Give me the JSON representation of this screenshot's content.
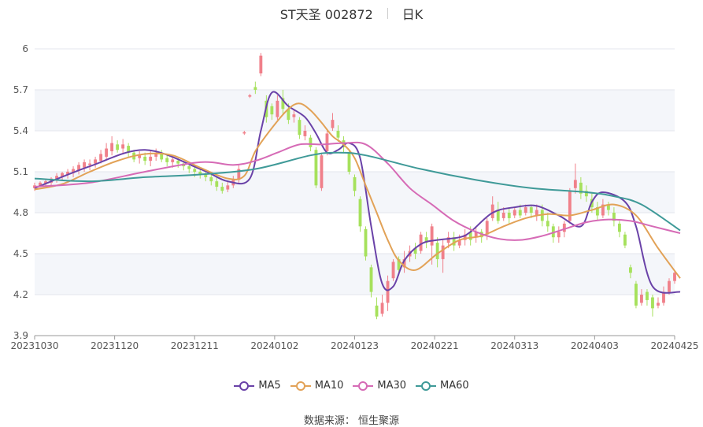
{
  "header": {
    "title": "ST天圣 002872",
    "period": "日K"
  },
  "source": "数据来源： 恒生聚源",
  "colors": {
    "up": "#f0808a",
    "down": "#a6e15c",
    "MA5": "#6a42a8",
    "MA10": "#e2a257",
    "MA30": "#d66bb6",
    "MA60": "#3f9a98"
  },
  "chart_data": {
    "type": "candlestick",
    "y_ticks": [
      "6",
      "5.7",
      "5.4",
      "5.1",
      "4.8",
      "4.5",
      "4.2",
      "3.9"
    ],
    "ylim": [
      3.9,
      6.0
    ],
    "x_tick_labels": [
      "20231030",
      "20231120",
      "20231211",
      "20240102",
      "20240123",
      "20240221",
      "20240313",
      "20240403",
      "20240425"
    ],
    "grid": true,
    "legend_position": "bottom",
    "legend": [
      "MA5",
      "MA10",
      "MA30",
      "MA60"
    ],
    "candles": [
      [
        4.98,
        5.0,
        4.96,
        5.02
      ],
      [
        5.0,
        5.02,
        4.99,
        5.03
      ],
      [
        5.01,
        5.03,
        4.99,
        5.05
      ],
      [
        5.02,
        5.05,
        5.0,
        5.06
      ],
      [
        5.04,
        5.07,
        5.02,
        5.09
      ],
      [
        5.06,
        5.09,
        5.04,
        5.1
      ],
      [
        5.08,
        5.1,
        5.05,
        5.12
      ],
      [
        5.09,
        5.12,
        5.06,
        5.14
      ],
      [
        5.11,
        5.15,
        5.08,
        5.17
      ],
      [
        5.13,
        5.17,
        5.1,
        5.19
      ],
      [
        5.15,
        5.16,
        5.11,
        5.19
      ],
      [
        5.16,
        5.19,
        5.13,
        5.21
      ],
      [
        5.18,
        5.23,
        5.16,
        5.26
      ],
      [
        5.21,
        5.27,
        5.19,
        5.31
      ],
      [
        5.25,
        5.31,
        5.22,
        5.36
      ],
      [
        5.3,
        5.26,
        5.24,
        5.33
      ],
      [
        5.27,
        5.3,
        5.23,
        5.34
      ],
      [
        5.29,
        5.24,
        5.21,
        5.31
      ],
      [
        5.24,
        5.19,
        5.17,
        5.26
      ],
      [
        5.2,
        5.22,
        5.16,
        5.25
      ],
      [
        5.21,
        5.18,
        5.15,
        5.24
      ],
      [
        5.18,
        5.21,
        5.14,
        5.25
      ],
      [
        5.21,
        5.24,
        5.18,
        5.27
      ],
      [
        5.24,
        5.19,
        5.17,
        5.26
      ],
      [
        5.2,
        5.17,
        5.14,
        5.22
      ],
      [
        5.17,
        5.19,
        5.13,
        5.21
      ],
      [
        5.18,
        5.16,
        5.13,
        5.2
      ],
      [
        5.16,
        5.14,
        5.11,
        5.18
      ],
      [
        5.14,
        5.12,
        5.09,
        5.16
      ],
      [
        5.12,
        5.1,
        5.06,
        5.14
      ],
      [
        5.1,
        5.08,
        5.05,
        5.13
      ],
      [
        5.08,
        5.06,
        5.03,
        5.11
      ],
      [
        5.06,
        5.03,
        5.0,
        5.09
      ],
      [
        5.03,
        4.99,
        4.96,
        5.06
      ],
      [
        4.99,
        4.96,
        4.94,
        5.02
      ],
      [
        4.97,
        5.0,
        4.95,
        5.03
      ],
      [
        5.0,
        5.04,
        4.98,
        5.07
      ],
      [
        5.04,
        5.12,
        5.02,
        5.15
      ],
      [
        5.38,
        5.39,
        5.37,
        5.4
      ],
      [
        5.65,
        5.66,
        5.64,
        5.67
      ],
      [
        5.72,
        5.7,
        5.67,
        5.76
      ],
      [
        5.82,
        5.95,
        5.8,
        5.97
      ],
      [
        5.62,
        5.5,
        5.46,
        5.66
      ],
      [
        5.58,
        5.52,
        5.48,
        5.6
      ],
      [
        5.5,
        5.62,
        5.48,
        5.66
      ],
      [
        5.64,
        5.56,
        5.52,
        5.7
      ],
      [
        5.56,
        5.48,
        5.45,
        5.6
      ],
      [
        5.5,
        5.52,
        5.46,
        5.56
      ],
      [
        5.48,
        5.37,
        5.34,
        5.5
      ],
      [
        5.36,
        5.4,
        5.33,
        5.44
      ],
      [
        5.35,
        5.28,
        5.25,
        5.37
      ],
      [
        5.26,
        5.0,
        4.98,
        5.28
      ],
      [
        4.98,
        5.22,
        4.96,
        5.24
      ],
      [
        5.25,
        5.38,
        5.22,
        5.4
      ],
      [
        5.42,
        5.48,
        5.4,
        5.53
      ],
      [
        5.4,
        5.35,
        5.32,
        5.44
      ],
      [
        5.33,
        5.28,
        5.24,
        5.36
      ],
      [
        5.24,
        5.1,
        5.08,
        5.26
      ],
      [
        5.06,
        4.96,
        4.92,
        5.08
      ],
      [
        4.9,
        4.7,
        4.66,
        4.92
      ],
      [
        4.68,
        4.48,
        4.45,
        4.7
      ],
      [
        4.4,
        4.22,
        4.18,
        4.42
      ],
      [
        4.12,
        4.04,
        4.02,
        4.18
      ],
      [
        4.06,
        4.14,
        4.04,
        4.2
      ],
      [
        4.14,
        4.3,
        4.08,
        4.34
      ],
      [
        4.32,
        4.44,
        4.3,
        4.46
      ],
      [
        4.46,
        4.38,
        4.34,
        4.48
      ],
      [
        4.4,
        4.46,
        4.36,
        4.52
      ],
      [
        4.48,
        4.52,
        4.44,
        4.56
      ],
      [
        4.54,
        4.5,
        4.46,
        4.58
      ],
      [
        4.52,
        4.64,
        4.5,
        4.66
      ],
      [
        4.62,
        4.58,
        4.54,
        4.66
      ],
      [
        4.56,
        4.7,
        4.42,
        4.72
      ],
      [
        4.58,
        4.46,
        4.4,
        4.62
      ],
      [
        4.46,
        4.56,
        4.36,
        4.6
      ],
      [
        4.58,
        4.62,
        4.54,
        4.66
      ],
      [
        4.62,
        4.56,
        4.52,
        4.66
      ],
      [
        4.56,
        4.6,
        4.54,
        4.64
      ],
      [
        4.6,
        4.64,
        4.56,
        4.68
      ],
      [
        4.66,
        4.6,
        4.56,
        4.7
      ],
      [
        4.62,
        4.66,
        4.58,
        4.7
      ],
      [
        4.66,
        4.62,
        4.58,
        4.68
      ],
      [
        4.64,
        4.74,
        4.6,
        4.76
      ],
      [
        4.76,
        4.86,
        4.74,
        4.92
      ],
      [
        4.82,
        4.74,
        4.72,
        4.88
      ],
      [
        4.76,
        4.8,
        4.74,
        4.84
      ],
      [
        4.8,
        4.76,
        4.72,
        4.84
      ],
      [
        4.78,
        4.82,
        4.76,
        4.84
      ],
      [
        4.82,
        4.78,
        4.76,
        4.86
      ],
      [
        4.8,
        4.84,
        4.78,
        4.86
      ],
      [
        4.84,
        4.8,
        4.76,
        4.86
      ],
      [
        4.78,
        4.82,
        4.74,
        4.86
      ],
      [
        4.82,
        4.74,
        4.7,
        4.86
      ],
      [
        4.74,
        4.7,
        4.66,
        4.8
      ],
      [
        4.7,
        4.62,
        4.58,
        4.72
      ],
      [
        4.62,
        4.66,
        4.58,
        4.7
      ],
      [
        4.66,
        4.72,
        4.62,
        4.74
      ],
      [
        4.74,
        4.96,
        4.72,
        4.98
      ],
      [
        4.98,
        5.04,
        4.94,
        5.16
      ],
      [
        5.02,
        4.94,
        4.9,
        5.06
      ],
      [
        4.96,
        4.92,
        4.88,
        5.0
      ],
      [
        4.9,
        4.84,
        4.8,
        4.94
      ],
      [
        4.84,
        4.78,
        4.74,
        4.88
      ],
      [
        4.78,
        4.86,
        4.76,
        4.9
      ],
      [
        4.86,
        4.82,
        4.78,
        4.88
      ],
      [
        4.8,
        4.74,
        4.7,
        4.84
      ],
      [
        4.72,
        4.66,
        4.62,
        4.74
      ],
      [
        4.64,
        4.56,
        4.54,
        4.66
      ],
      [
        4.4,
        4.36,
        4.32,
        4.42
      ],
      [
        4.28,
        4.12,
        4.1,
        4.3
      ],
      [
        4.14,
        4.2,
        4.12,
        4.24
      ],
      [
        4.22,
        4.16,
        4.12,
        4.24
      ],
      [
        4.18,
        4.1,
        4.04,
        4.2
      ],
      [
        4.12,
        4.14,
        4.1,
        4.18
      ],
      [
        4.14,
        4.22,
        4.12,
        4.26
      ],
      [
        4.22,
        4.3,
        4.2,
        4.32
      ],
      [
        4.3,
        4.36,
        4.28,
        4.38
      ]
    ],
    "series": [
      {
        "name": "MA5",
        "x": [
          0,
          10,
          20,
          30,
          35,
          39,
          41,
          43,
          46,
          49,
          51,
          53,
          55,
          57,
          59,
          61,
          63,
          65,
          67,
          70,
          73,
          77,
          79,
          83,
          87,
          91,
          95,
          99,
          101,
          103,
          107,
          109,
          112,
          117
        ],
        "values": [
          4.98,
          5.14,
          5.26,
          5.12,
          5.03,
          5.05,
          5.4,
          5.68,
          5.58,
          5.5,
          5.38,
          5.24,
          5.26,
          5.31,
          5.2,
          4.7,
          4.28,
          4.26,
          4.45,
          4.57,
          4.6,
          4.62,
          4.66,
          4.8,
          4.84,
          4.85,
          4.78,
          4.7,
          4.88,
          4.95,
          4.88,
          4.7,
          4.26,
          4.22
        ]
      },
      {
        "name": "MA10",
        "x": [
          0,
          5,
          10,
          15,
          20,
          25,
          30,
          35,
          38,
          40,
          43,
          46,
          48,
          50,
          52,
          54,
          56,
          58,
          60,
          62,
          64,
          66,
          69,
          73,
          77,
          81,
          85,
          89,
          93,
          97,
          101,
          105,
          109,
          113,
          117
        ],
        "values": [
          4.97,
          5.01,
          5.1,
          5.18,
          5.23,
          5.22,
          5.13,
          5.05,
          5.07,
          5.25,
          5.42,
          5.56,
          5.6,
          5.55,
          5.46,
          5.36,
          5.3,
          5.2,
          5.0,
          4.8,
          4.6,
          4.45,
          4.38,
          4.5,
          4.6,
          4.63,
          4.7,
          4.76,
          4.79,
          4.78,
          4.82,
          4.86,
          4.78,
          4.54,
          4.32
        ]
      },
      {
        "name": "MA30",
        "x": [
          0,
          10,
          20,
          30,
          36,
          40,
          44,
          48,
          52,
          56,
          60,
          64,
          68,
          72,
          76,
          80,
          84,
          88,
          92,
          96,
          100,
          104,
          108,
          112,
          117
        ],
        "values": [
          4.99,
          5.02,
          5.1,
          5.17,
          5.15,
          5.18,
          5.24,
          5.3,
          5.3,
          5.31,
          5.3,
          5.16,
          4.98,
          4.86,
          4.74,
          4.66,
          4.61,
          4.6,
          4.63,
          4.68,
          4.73,
          4.75,
          4.74,
          4.7,
          4.65
        ]
      },
      {
        "name": "MA60",
        "x": [
          0,
          10,
          20,
          30,
          40,
          50,
          55,
          60,
          70,
          80,
          90,
          100,
          105,
          110,
          117
        ],
        "values": [
          5.05,
          5.03,
          5.06,
          5.08,
          5.12,
          5.22,
          5.24,
          5.22,
          5.12,
          5.04,
          4.98,
          4.95,
          4.92,
          4.86,
          4.67
        ]
      }
    ]
  }
}
